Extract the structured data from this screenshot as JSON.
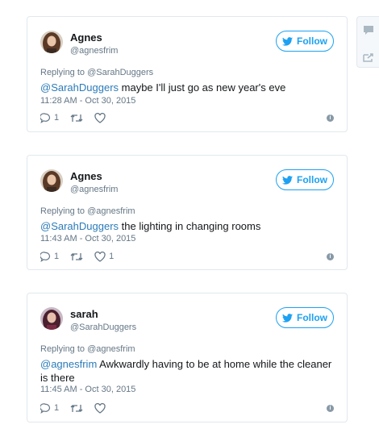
{
  "follow_label": "Follow",
  "info_glyph": "i",
  "colors": {
    "brand_blue": "#1da1f2",
    "mention_blue": "#2b7bb9",
    "muted": "#657786"
  },
  "tweets": [
    {
      "name": "Agnes",
      "handle": "@agnesfrim",
      "replying_to": "Replying to @SarahDuggers",
      "mention": "@SarahDuggers",
      "text": " maybe I'll just go as new year's eve",
      "timestamp": "11:28 AM - Oct 30, 2015",
      "reply_count": "1",
      "like_count": ""
    },
    {
      "name": "Agnes",
      "handle": "@agnesfrim",
      "replying_to": "Replying to @agnesfrim",
      "mention": "@SarahDuggers",
      "text": " the lighting in changing rooms",
      "timestamp": "11:43 AM - Oct 30, 2015",
      "reply_count": "1",
      "like_count": "1"
    },
    {
      "name": "sarah",
      "handle": "@SarahDuggers",
      "replying_to": "Replying to @agnesfrim",
      "mention": "@agnesfrim",
      "text": " Awkwardly having to be at home while the cleaner is there",
      "timestamp": "11:45 AM - Oct 30, 2015",
      "reply_count": "1",
      "like_count": ""
    }
  ]
}
